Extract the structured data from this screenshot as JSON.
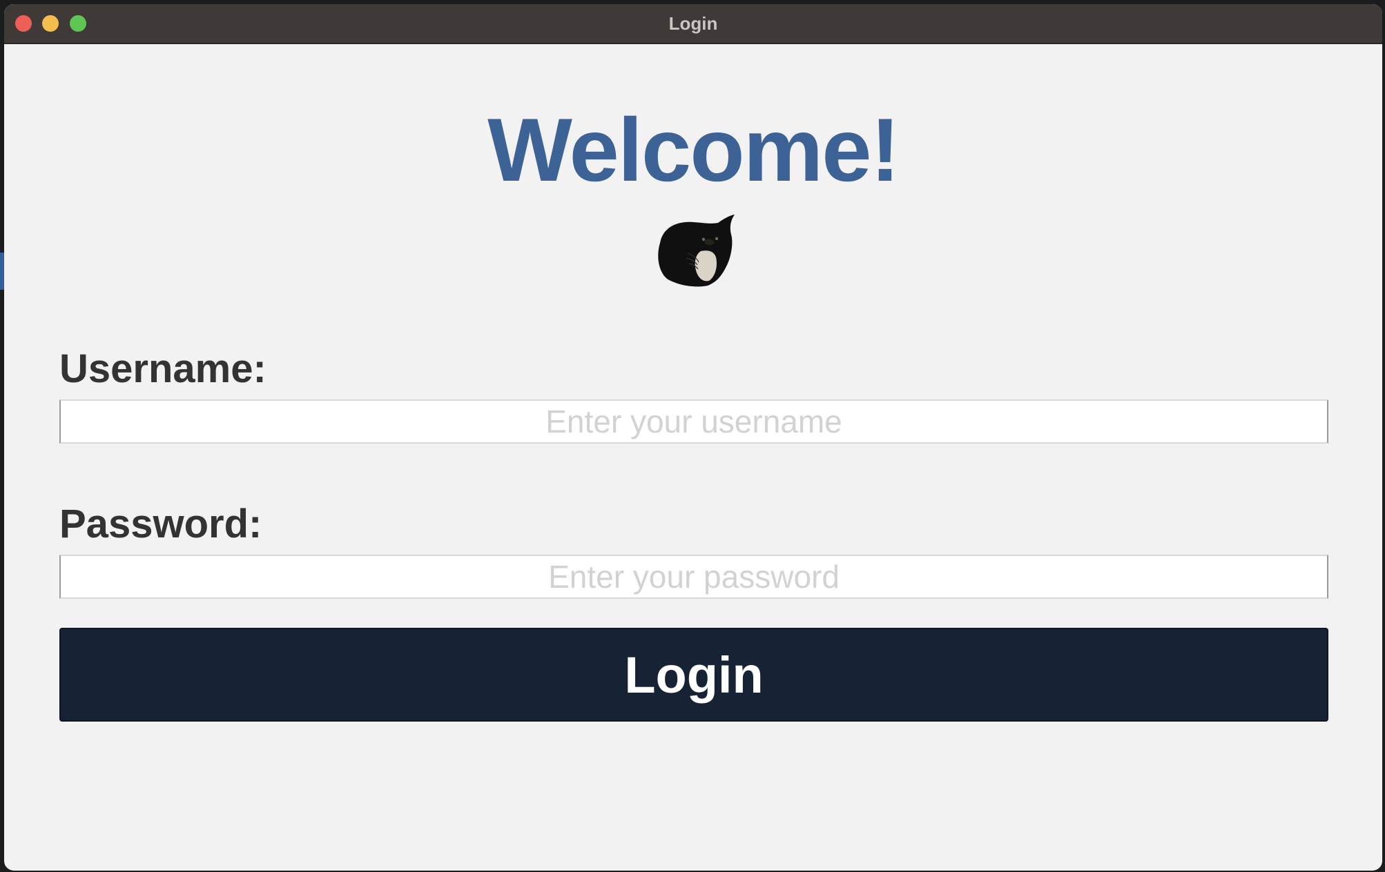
{
  "window": {
    "title": "Login"
  },
  "content": {
    "heading": "Welcome!",
    "avatar_icon": "cat-image"
  },
  "form": {
    "username_label": "Username:",
    "username_placeholder": "Enter your username",
    "username_value": "",
    "password_label": "Password:",
    "password_placeholder": "Enter your password",
    "password_value": "",
    "submit_label": "Login"
  },
  "colors": {
    "titlebar": "#3f3a37",
    "background": "#f2f2f2",
    "heading": "#3d6296",
    "button": "#172235",
    "label": "#333333"
  }
}
